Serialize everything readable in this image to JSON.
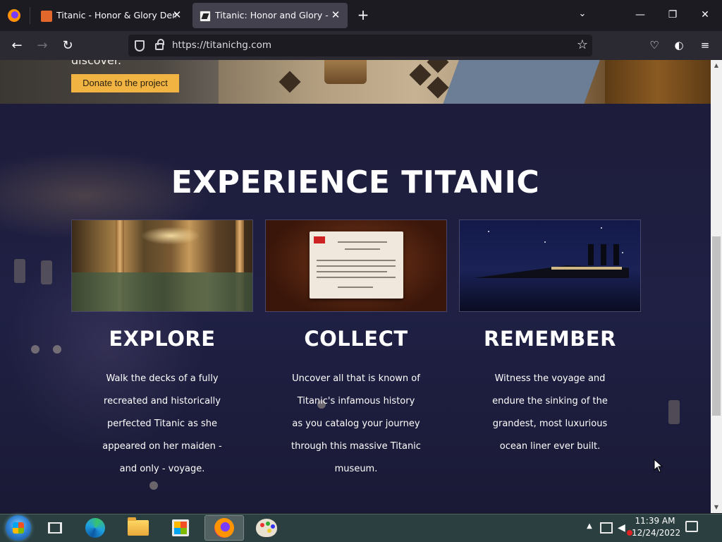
{
  "browser": {
    "tabs": [
      {
        "title": "Titanic - Honor & Glory Demos",
        "active": false
      },
      {
        "title": "Titanic: Honor and Glory - Home",
        "active": true
      }
    ],
    "url": "https://titanichg.com"
  },
  "page": {
    "hero": {
      "discover_text": "discover.",
      "donate_label": "Donate to the project"
    },
    "headline": "EXPERIENCE TITANIC",
    "cards": [
      {
        "title": "EXPLORE",
        "text_lines": [
          "Walk the decks of a fully",
          "recreated and historically",
          "perfected Titanic as she",
          "appeared on her maiden -",
          "and only - voyage."
        ]
      },
      {
        "title": "COLLECT",
        "text_lines": [
          "Uncover all that is known of",
          "Titanic's infamous history",
          "as you catalog your journey",
          "through this massive Titanic",
          "museum."
        ]
      },
      {
        "title": "REMEMBER",
        "text_lines": [
          "Witness the voyage and",
          "endure the sinking of the",
          "grandest, most luxurious",
          "ocean liner ever built."
        ]
      }
    ]
  },
  "taskbar": {
    "clock_time": "11:39 AM",
    "clock_date": "12/24/2022"
  },
  "colors": {
    "accent_button": "#f1b342",
    "section_bg": "#1d1c3a",
    "browser_bg": "#1c1b22"
  }
}
